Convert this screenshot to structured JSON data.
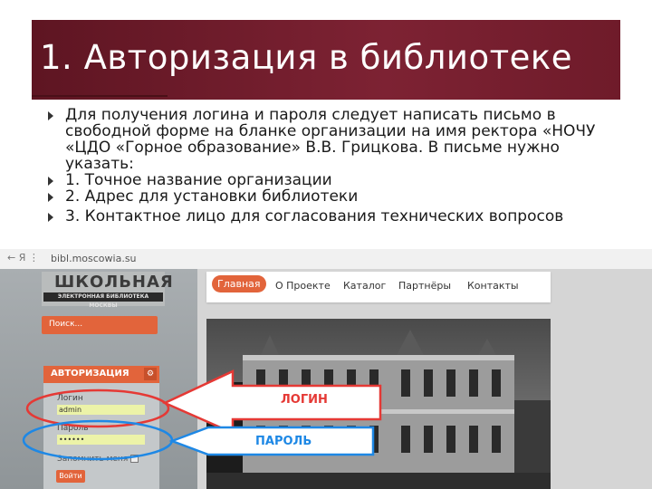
{
  "slide": {
    "title": "1. Авторизация в библиотеке",
    "bullets": [
      "Для получения логина и пароля следует написать письмо в свободной форме на бланке организации на имя ректора «НОЧУ «ЦДО «Горное образование» В.В. Грицкова. В письме нужно указать:",
      "1. Точное название организации",
      "2. Адрес для установки библиотеки",
      "3. Контактное лицо для согласования технических вопросов"
    ]
  },
  "browser": {
    "nav": "←  Я  ⋮",
    "url": "bibl.moscowia.su"
  },
  "site": {
    "logo_title": "ШКОЛЬНАЯ",
    "logo_subtitle": "ЭЛЕКТРОННАЯ БИБЛИОТЕКА МОСКВЫ",
    "search_placeholder": "Поиск...",
    "auth_title": "АВТОРИЗАЦИЯ",
    "login_label": "Логин",
    "login_value": "admin",
    "password_label": "Пароль",
    "password_value": "••••••",
    "remember_label": "Запомнить меня",
    "login_button": "Войти",
    "menu": [
      "Главная",
      "О Проекте",
      "Каталог",
      "Партнёры",
      "Контакты"
    ]
  },
  "callouts": {
    "login": "ЛОГИН",
    "password": "ПАРОЛЬ",
    "login_color": "#e53935",
    "password_color": "#1e88e5"
  }
}
